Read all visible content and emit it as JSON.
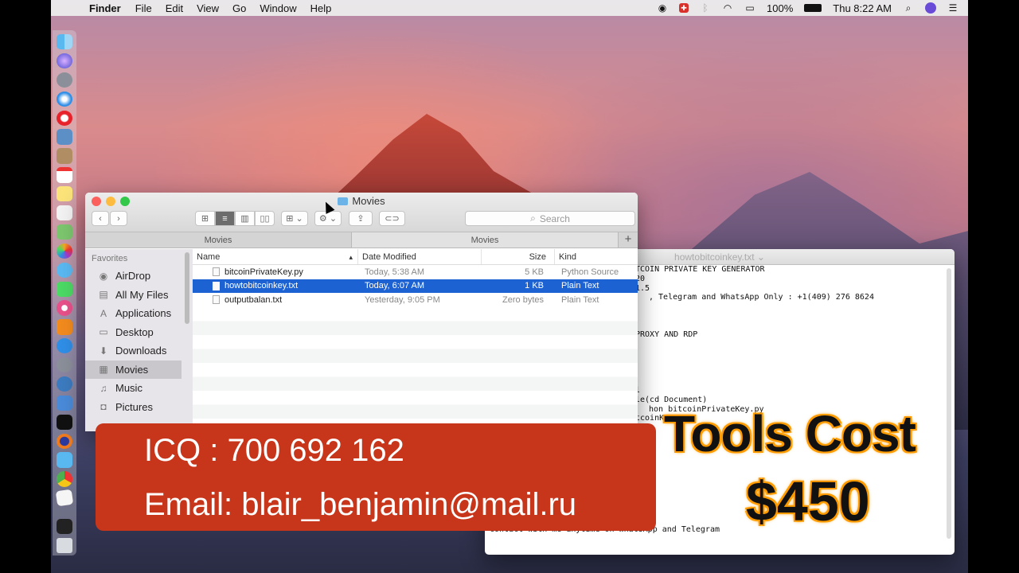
{
  "menubar": {
    "app_name": "Finder",
    "menus": [
      "File",
      "Edit",
      "View",
      "Go",
      "Window",
      "Help"
    ],
    "battery": "100%",
    "clock": "Thu 8:22 AM"
  },
  "finder": {
    "title": "Movies",
    "search_placeholder": "Search",
    "tabs": [
      "Movies",
      "Movies"
    ],
    "add_tab": "+",
    "sidebar": {
      "header": "Favorites",
      "items": [
        {
          "label": "AirDrop",
          "icon": "airdrop-icon",
          "glyph": "◉"
        },
        {
          "label": "All My Files",
          "icon": "all-files-icon",
          "glyph": "▤"
        },
        {
          "label": "Applications",
          "icon": "applications-icon",
          "glyph": "A"
        },
        {
          "label": "Desktop",
          "icon": "desktop-icon",
          "glyph": "▭"
        },
        {
          "label": "Downloads",
          "icon": "downloads-icon",
          "glyph": "⬇"
        },
        {
          "label": "Movies",
          "icon": "movies-icon",
          "glyph": "▦",
          "active": true
        },
        {
          "label": "Music",
          "icon": "music-icon",
          "glyph": "♫"
        },
        {
          "label": "Pictures",
          "icon": "pictures-icon",
          "glyph": "◘"
        }
      ]
    },
    "columns": {
      "name": "Name",
      "date": "Date Modified",
      "size": "Size",
      "kind": "Kind"
    },
    "files": [
      {
        "name": "bitcoinPrivateKey.py",
        "date": "Today, 5:38 AM",
        "size": "5 KB",
        "kind": "Python Source",
        "selected": false
      },
      {
        "name": "howtobitcoinkey.txt",
        "date": "Today, 6:07 AM",
        "size": "1 KB",
        "kind": "Plain Text",
        "selected": true
      },
      {
        "name": "outputbalan.txt",
        "date": "Yesterday, 9:05 PM",
        "size": "Zero bytes",
        "kind": "Plain Text",
        "selected": false
      }
    ]
  },
  "textedit": {
    "title": "howtobitcoinkey.txt",
    "lines": [
      "TCOIN PRIVATE KEY GENERATOR",
      "20",
      "1.5",
      ", Telegram and WhatsApp Only : +1(409) 276 8624",
      "PROXY AND RDP",
      "l",
      "le(cd Document)",
      "hon bitcoinPrivateKey.py",
      "tcoinKey.py",
      "contact with me anytime on WhatsApp and Telegram"
    ]
  },
  "overlay": {
    "icq": "ICQ : 700 692 162",
    "email": "Email: blair_benjamin@mail.ru",
    "promo_title": "Tools Cost",
    "promo_price": "$450"
  }
}
